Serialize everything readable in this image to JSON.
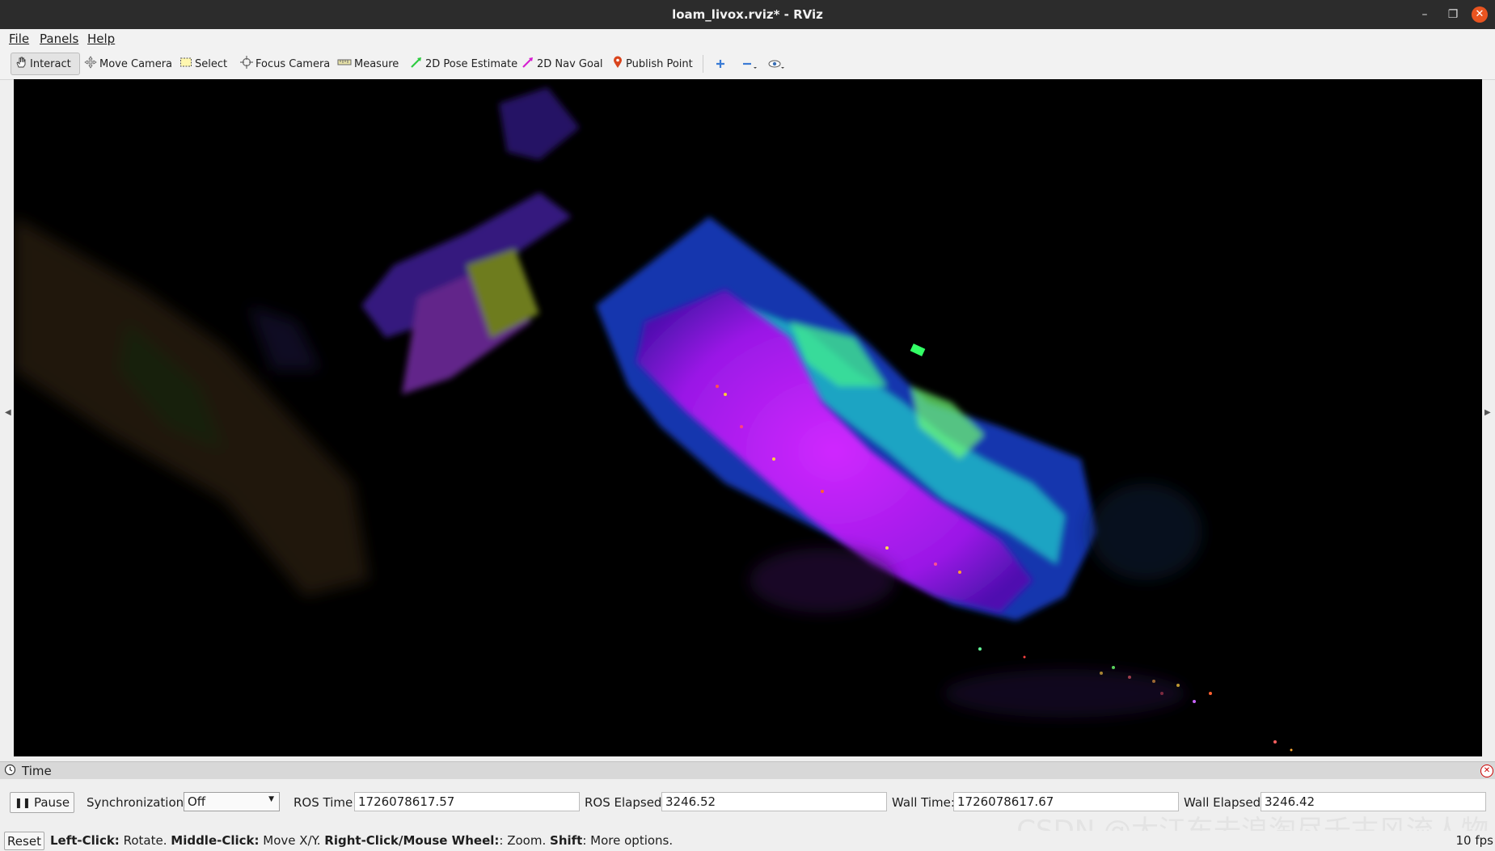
{
  "window": {
    "title": "loam_livox.rviz* - RViz"
  },
  "menu": [
    "File",
    "Panels",
    "Help"
  ],
  "toolbar": {
    "tools": [
      {
        "label": "Interact",
        "icon": "hand-icon",
        "active": true
      },
      {
        "label": "Move Camera",
        "icon": "move-arrows-icon",
        "active": false
      },
      {
        "label": "Select",
        "icon": "select-box-icon",
        "active": false
      },
      {
        "label": "Focus Camera",
        "icon": "focus-crosshair-icon",
        "active": false
      },
      {
        "label": "Measure",
        "icon": "ruler-icon",
        "active": false
      },
      {
        "label": "2D Pose Estimate",
        "icon": "green-arrow-icon",
        "active": false
      },
      {
        "label": "2D Nav Goal",
        "icon": "magenta-arrow-icon",
        "active": false
      },
      {
        "label": "Publish Point",
        "icon": "map-pin-icon",
        "active": false
      }
    ],
    "extra_icons": [
      "plus-icon",
      "minus-icon",
      "eye-icon"
    ]
  },
  "time_panel": {
    "title": "Time",
    "pause_label": "Pause",
    "sync_label": "Synchronization:",
    "sync_value": "Off",
    "ros_time_label": "ROS Time:",
    "ros_time": "1726078617.57",
    "ros_elapsed_label": "ROS Elapsed:",
    "ros_elapsed": "3246.52",
    "wall_time_label": "Wall Time:",
    "wall_time": "1726078617.67",
    "wall_elapsed_label": "Wall Elapsed:",
    "wall_elapsed": "3246.42"
  },
  "status": {
    "reset_label": "Reset",
    "left_click": "Left-Click:",
    "left_click_desc": "Rotate.",
    "middle_click": "Middle-Click:",
    "middle_click_desc": "Move X/Y.",
    "right_click": "Right-Click/Mouse Wheel:",
    "right_click_desc": ": Zoom.",
    "shift": "Shift",
    "shift_desc": ": More options.",
    "fps": "10 fps"
  },
  "watermark": "CSDN @大江东去浪淘尽千古风流人物",
  "colors": {
    "accent": "#e95420",
    "cloud_purple": "#a020f0",
    "cloud_blue": "#2a5cff",
    "cloud_green": "#33ff99"
  }
}
